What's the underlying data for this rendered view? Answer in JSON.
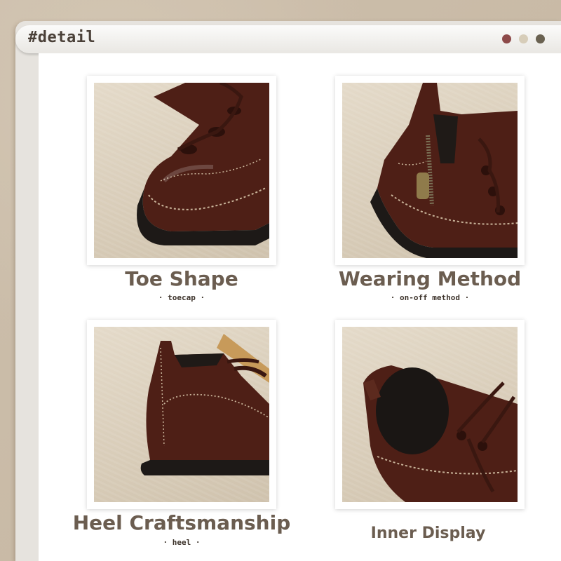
{
  "window": {
    "title": "#detail",
    "dots": [
      {
        "name": "red",
        "color": "#8d4a49"
      },
      {
        "name": "beige",
        "color": "#d7cdb9"
      },
      {
        "name": "olive",
        "color": "#6a6251"
      }
    ]
  },
  "details": [
    {
      "title": "Toe Shape",
      "subtitle": "· toecap ·",
      "image": "boot-toe-photo"
    },
    {
      "title": "Wearing Method",
      "subtitle": "· on-off method ·",
      "image": "boot-zipper-photo"
    },
    {
      "title": "Heel Craftsmanship",
      "subtitle": "· heel ·",
      "image": "boot-heel-photo"
    },
    {
      "title": "Inner Display",
      "subtitle": "",
      "image": "boot-inner-photo"
    }
  ],
  "colors": {
    "leather": "#4e1f16",
    "caption": "#6b5d50",
    "subtitle": "#3d332b",
    "background": "#c9bba7"
  }
}
